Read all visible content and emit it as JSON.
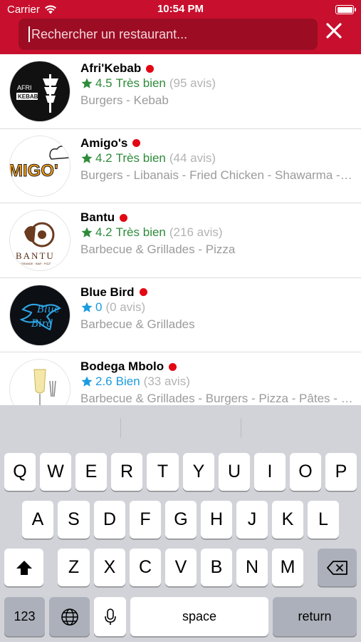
{
  "status_bar": {
    "carrier": "Carrier",
    "time": "10:54 PM"
  },
  "header": {
    "search_placeholder": "Rechercher un restaurant...",
    "close_icon": "close-icon",
    "bg_color": "#c8102e"
  },
  "restaurants": [
    {
      "name": "Afri'Kebab",
      "score": "4.5",
      "label": "Très bien",
      "reviews": "(95 avis)",
      "categories": "Burgers - Kebab",
      "star_color": "#2e8b3a",
      "logo_text": [
        "AFRI",
        "KEBAB"
      ]
    },
    {
      "name": "Amigo's",
      "score": "4.2",
      "label": "Très bien",
      "reviews": "(44 avis)",
      "categories": "Burgers - Libanais - Fried Chicken - Shawarma - Tacos",
      "star_color": "#2e8b3a",
      "logo_text": [
        "MIGO'"
      ]
    },
    {
      "name": "Bantu",
      "score": "4.2",
      "label": "Très bien",
      "reviews": "(216 avis)",
      "categories": "Barbecue & Grillades - Pizza",
      "star_color": "#2e8b3a",
      "logo_text": [
        "BANTU",
        "\"GRANDE · BAR · PIZZ\""
      ]
    },
    {
      "name": "Blue Bird",
      "score": "0",
      "label": "",
      "reviews": "(0 avis)",
      "categories": "Barbecue & Grillades",
      "star_color": "#1a9be0",
      "logo_text": [
        "Blue",
        "Bird"
      ]
    },
    {
      "name": "Bodega Mbolo",
      "score": "2.6",
      "label": "Bien",
      "reviews": "(33 avis)",
      "categories": "Barbecue & Grillades - Burgers - Pizza - Pâtes - Salades",
      "star_color": "#1a9be0",
      "logo_text": []
    }
  ],
  "keyboard": {
    "row1": [
      "Q",
      "W",
      "E",
      "R",
      "T",
      "Y",
      "U",
      "I",
      "O",
      "P"
    ],
    "row2": [
      "A",
      "S",
      "D",
      "F",
      "G",
      "H",
      "J",
      "K",
      "L"
    ],
    "row3": [
      "Z",
      "X",
      "C",
      "V",
      "B",
      "N",
      "M"
    ],
    "numbers_label": "123",
    "space_label": "space",
    "return_label": "return"
  }
}
